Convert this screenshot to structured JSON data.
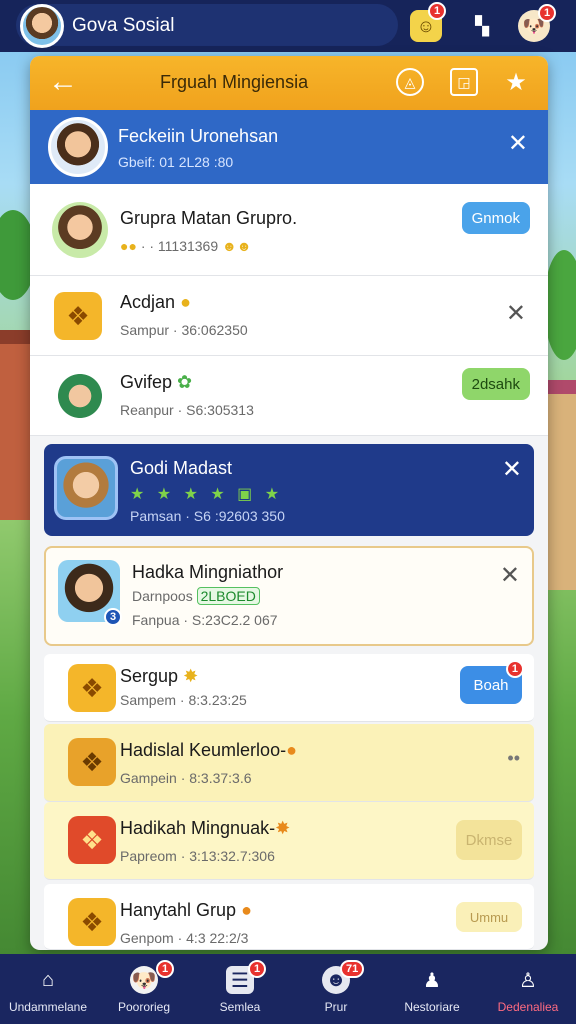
{
  "app": {
    "title": "Gova Sosial",
    "badges": {
      "messages": "1",
      "pet": "1"
    }
  },
  "panel": {
    "title": "Frguah Mingiensia",
    "back_icon": "arrow-left-icon",
    "header_icons": [
      "compass-icon",
      "image-icon",
      "star-icon"
    ]
  },
  "profile": {
    "name": "Feckeiin Uronehsan",
    "sub": "Gbeif: 01 2L28 :80"
  },
  "rows": [
    {
      "name": "Grupra Matan Grupro.",
      "sub": "· · 11131369",
      "action": "Gnmok"
    },
    {
      "name": "Acdjan",
      "sub": "Sampur · 36:062350"
    },
    {
      "name": "Gvifep",
      "sub": "Reanpur · S6:305313",
      "action": "2dsahk"
    }
  ],
  "highlight_card": {
    "name": "Godi Madast",
    "stars": "★ ★ ★ ★ ▣ ★",
    "sub": "Pamsan · S6 :92603 350"
  },
  "gold_card": {
    "name": "Hadka Mingniathor",
    "sub1_prefix": "Darnpoos",
    "sub1_tag": "2LBOED",
    "sub2": "Fanpua · S:23C2.2 067",
    "badge": "3"
  },
  "list2": [
    {
      "name": "Sergup",
      "sub": "Sampem · 8:3.23:25",
      "action": "Boah",
      "badge": "1"
    },
    {
      "name": "Hadislal Keumlerloo-",
      "sub": "Gampein · 8:3.37:3.6"
    },
    {
      "name": "Hadikah Mingnuak-",
      "sub": "Papreom · 3:13:32.7:306",
      "action": "Dkmse"
    },
    {
      "name": "Hanytahl Grup",
      "sub": "Genpom · 4:3 22:2/3",
      "action": "Ummu"
    }
  ],
  "nav": [
    {
      "label": "Undammelane",
      "icon": "home-icon"
    },
    {
      "label": "Poororieg",
      "icon": "pet-icon",
      "badge": "1"
    },
    {
      "label": "Semlea",
      "icon": "list-icon",
      "badge": "1"
    },
    {
      "label": "Prur",
      "icon": "chat-icon",
      "badge": "71"
    },
    {
      "label": "Nestoriare",
      "icon": "people-icon"
    },
    {
      "label": "Dedenaliea",
      "icon": "person-icon"
    }
  ],
  "colors": {
    "topbar": "#16245a",
    "header": "#f7b52a",
    "profile_bg": "#2f68c6",
    "highlight_card": "#1f3a8a",
    "nav_active": "#ff6b81"
  }
}
